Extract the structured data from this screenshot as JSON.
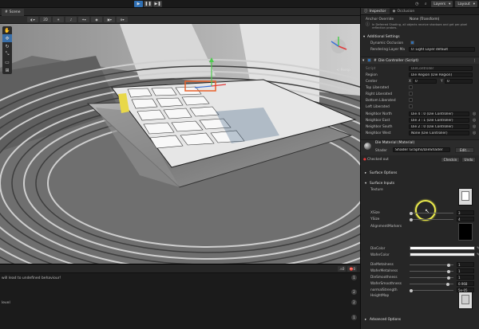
{
  "toolbar": {
    "play_icon": "play-icon",
    "pause_icon": "pause-icon",
    "step_icon": "step-icon",
    "layers_label": "Layers",
    "layout_label": "Layout"
  },
  "scene": {
    "tab_label": "Scene",
    "persp_label": "< Persp"
  },
  "console": {
    "warn_count": "0",
    "error_count": "0",
    "lines": [
      {
        "text": "will lead to undefined behaviour!",
        "count": "1"
      },
      {
        "text": "",
        "count": "2"
      },
      {
        "text": "level",
        "count": "2"
      },
      {
        "text": "",
        "count": "1"
      }
    ]
  },
  "inspector": {
    "tabs": [
      "Inspector",
      "Occlusion"
    ],
    "anchor_override": {
      "label": "Anchor Override",
      "value": "None (Transform)"
    },
    "note": "In Deferred Shading, all objects receive shadows and get per-pixel reflection probes.",
    "additional_settings": "Additional Settings",
    "dynamic_occlusion": "Dynamic Occlusion",
    "rendering_layer_mask": {
      "label": "Rendering Layer Ma",
      "value": "0: Light Layer default"
    },
    "component_title": "Die Controller (Script)",
    "script": {
      "label": "Script",
      "value": "DieController"
    },
    "region": {
      "label": "Region",
      "value": "Die Region (Die Region)"
    },
    "center": {
      "label": "Center",
      "x_label": "X",
      "x": "0",
      "y_label": "Y",
      "y": "0"
    },
    "bool_rows": [
      "Top Liberated",
      "Right Liberated",
      "Bottom Liberated",
      "Left Liberated"
    ],
    "neighbors": [
      {
        "label": "Neighbor North",
        "value": "Die 4 : 0 (Die Controller)"
      },
      {
        "label": "Neighbor East",
        "value": "Die 3 : 1 (Die Controller)"
      },
      {
        "label": "Neighbor South",
        "value": "Die 2 : 0 (Die Controller)"
      },
      {
        "label": "Neighbor West",
        "value": "None (Die Controller)"
      }
    ],
    "material": {
      "name": "Die Material (Material)",
      "shader_label": "Shader",
      "shader_value": "Shader Graphs/DieShader",
      "edit": "Edit...",
      "checked_out": "Checked out",
      "checkin": "Checkin",
      "undo": "Undo"
    },
    "surface_options": "Surface Options",
    "surface_inputs": "Surface Inputs",
    "texture_label": "Texture",
    "xsize": {
      "label": "XSize",
      "value": "3"
    },
    "ysize": {
      "label": "YSize",
      "value": "4"
    },
    "alignment_markers": "AlignmentMarkers",
    "die_color": "DieColor",
    "wafer_color": "WaferColor",
    "sliders": [
      {
        "label": "DieMetalness",
        "value": "1",
        "fraction": 0.93
      },
      {
        "label": "WaferMetalness",
        "value": "1",
        "fraction": 0.93
      },
      {
        "label": "DieSmoothness",
        "value": "1",
        "fraction": 0.93
      },
      {
        "label": "WaferSmoothness",
        "value": "0.968",
        "fraction": 0.9
      },
      {
        "label": "normalStrength",
        "value": "5e-05",
        "fraction": 0.0
      }
    ],
    "height_map": "HeightMap",
    "advanced_options": "Advanced Options"
  },
  "colors": {
    "accent": "#2f6fb3",
    "highlight": "#e8e84c",
    "selection": "#e8602a"
  }
}
